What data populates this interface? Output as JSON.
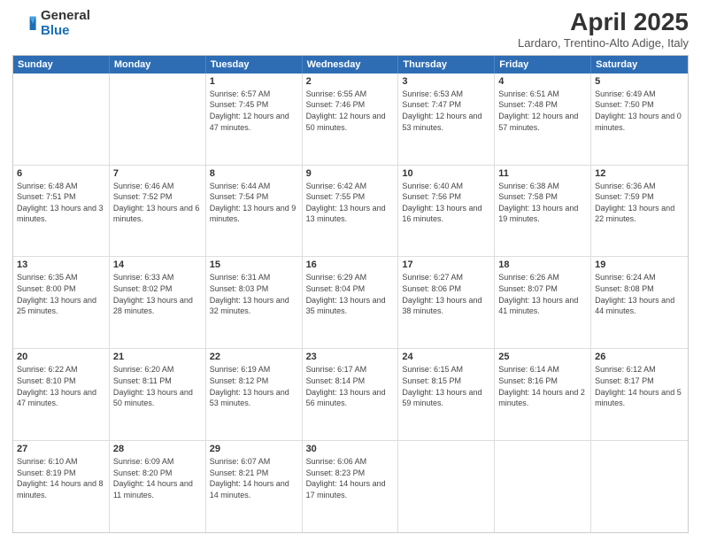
{
  "logo": {
    "general": "General",
    "blue": "Blue"
  },
  "title": "April 2025",
  "location": "Lardaro, Trentino-Alto Adige, Italy",
  "header_days": [
    "Sunday",
    "Monday",
    "Tuesday",
    "Wednesday",
    "Thursday",
    "Friday",
    "Saturday"
  ],
  "weeks": [
    [
      {
        "day": "",
        "info": ""
      },
      {
        "day": "",
        "info": ""
      },
      {
        "day": "1",
        "info": "Sunrise: 6:57 AM\nSunset: 7:45 PM\nDaylight: 12 hours and 47 minutes."
      },
      {
        "day": "2",
        "info": "Sunrise: 6:55 AM\nSunset: 7:46 PM\nDaylight: 12 hours and 50 minutes."
      },
      {
        "day": "3",
        "info": "Sunrise: 6:53 AM\nSunset: 7:47 PM\nDaylight: 12 hours and 53 minutes."
      },
      {
        "day": "4",
        "info": "Sunrise: 6:51 AM\nSunset: 7:48 PM\nDaylight: 12 hours and 57 minutes."
      },
      {
        "day": "5",
        "info": "Sunrise: 6:49 AM\nSunset: 7:50 PM\nDaylight: 13 hours and 0 minutes."
      }
    ],
    [
      {
        "day": "6",
        "info": "Sunrise: 6:48 AM\nSunset: 7:51 PM\nDaylight: 13 hours and 3 minutes."
      },
      {
        "day": "7",
        "info": "Sunrise: 6:46 AM\nSunset: 7:52 PM\nDaylight: 13 hours and 6 minutes."
      },
      {
        "day": "8",
        "info": "Sunrise: 6:44 AM\nSunset: 7:54 PM\nDaylight: 13 hours and 9 minutes."
      },
      {
        "day": "9",
        "info": "Sunrise: 6:42 AM\nSunset: 7:55 PM\nDaylight: 13 hours and 13 minutes."
      },
      {
        "day": "10",
        "info": "Sunrise: 6:40 AM\nSunset: 7:56 PM\nDaylight: 13 hours and 16 minutes."
      },
      {
        "day": "11",
        "info": "Sunrise: 6:38 AM\nSunset: 7:58 PM\nDaylight: 13 hours and 19 minutes."
      },
      {
        "day": "12",
        "info": "Sunrise: 6:36 AM\nSunset: 7:59 PM\nDaylight: 13 hours and 22 minutes."
      }
    ],
    [
      {
        "day": "13",
        "info": "Sunrise: 6:35 AM\nSunset: 8:00 PM\nDaylight: 13 hours and 25 minutes."
      },
      {
        "day": "14",
        "info": "Sunrise: 6:33 AM\nSunset: 8:02 PM\nDaylight: 13 hours and 28 minutes."
      },
      {
        "day": "15",
        "info": "Sunrise: 6:31 AM\nSunset: 8:03 PM\nDaylight: 13 hours and 32 minutes."
      },
      {
        "day": "16",
        "info": "Sunrise: 6:29 AM\nSunset: 8:04 PM\nDaylight: 13 hours and 35 minutes."
      },
      {
        "day": "17",
        "info": "Sunrise: 6:27 AM\nSunset: 8:06 PM\nDaylight: 13 hours and 38 minutes."
      },
      {
        "day": "18",
        "info": "Sunrise: 6:26 AM\nSunset: 8:07 PM\nDaylight: 13 hours and 41 minutes."
      },
      {
        "day": "19",
        "info": "Sunrise: 6:24 AM\nSunset: 8:08 PM\nDaylight: 13 hours and 44 minutes."
      }
    ],
    [
      {
        "day": "20",
        "info": "Sunrise: 6:22 AM\nSunset: 8:10 PM\nDaylight: 13 hours and 47 minutes."
      },
      {
        "day": "21",
        "info": "Sunrise: 6:20 AM\nSunset: 8:11 PM\nDaylight: 13 hours and 50 minutes."
      },
      {
        "day": "22",
        "info": "Sunrise: 6:19 AM\nSunset: 8:12 PM\nDaylight: 13 hours and 53 minutes."
      },
      {
        "day": "23",
        "info": "Sunrise: 6:17 AM\nSunset: 8:14 PM\nDaylight: 13 hours and 56 minutes."
      },
      {
        "day": "24",
        "info": "Sunrise: 6:15 AM\nSunset: 8:15 PM\nDaylight: 13 hours and 59 minutes."
      },
      {
        "day": "25",
        "info": "Sunrise: 6:14 AM\nSunset: 8:16 PM\nDaylight: 14 hours and 2 minutes."
      },
      {
        "day": "26",
        "info": "Sunrise: 6:12 AM\nSunset: 8:17 PM\nDaylight: 14 hours and 5 minutes."
      }
    ],
    [
      {
        "day": "27",
        "info": "Sunrise: 6:10 AM\nSunset: 8:19 PM\nDaylight: 14 hours and 8 minutes."
      },
      {
        "day": "28",
        "info": "Sunrise: 6:09 AM\nSunset: 8:20 PM\nDaylight: 14 hours and 11 minutes."
      },
      {
        "day": "29",
        "info": "Sunrise: 6:07 AM\nSunset: 8:21 PM\nDaylight: 14 hours and 14 minutes."
      },
      {
        "day": "30",
        "info": "Sunrise: 6:06 AM\nSunset: 8:23 PM\nDaylight: 14 hours and 17 minutes."
      },
      {
        "day": "",
        "info": ""
      },
      {
        "day": "",
        "info": ""
      },
      {
        "day": "",
        "info": ""
      }
    ]
  ]
}
